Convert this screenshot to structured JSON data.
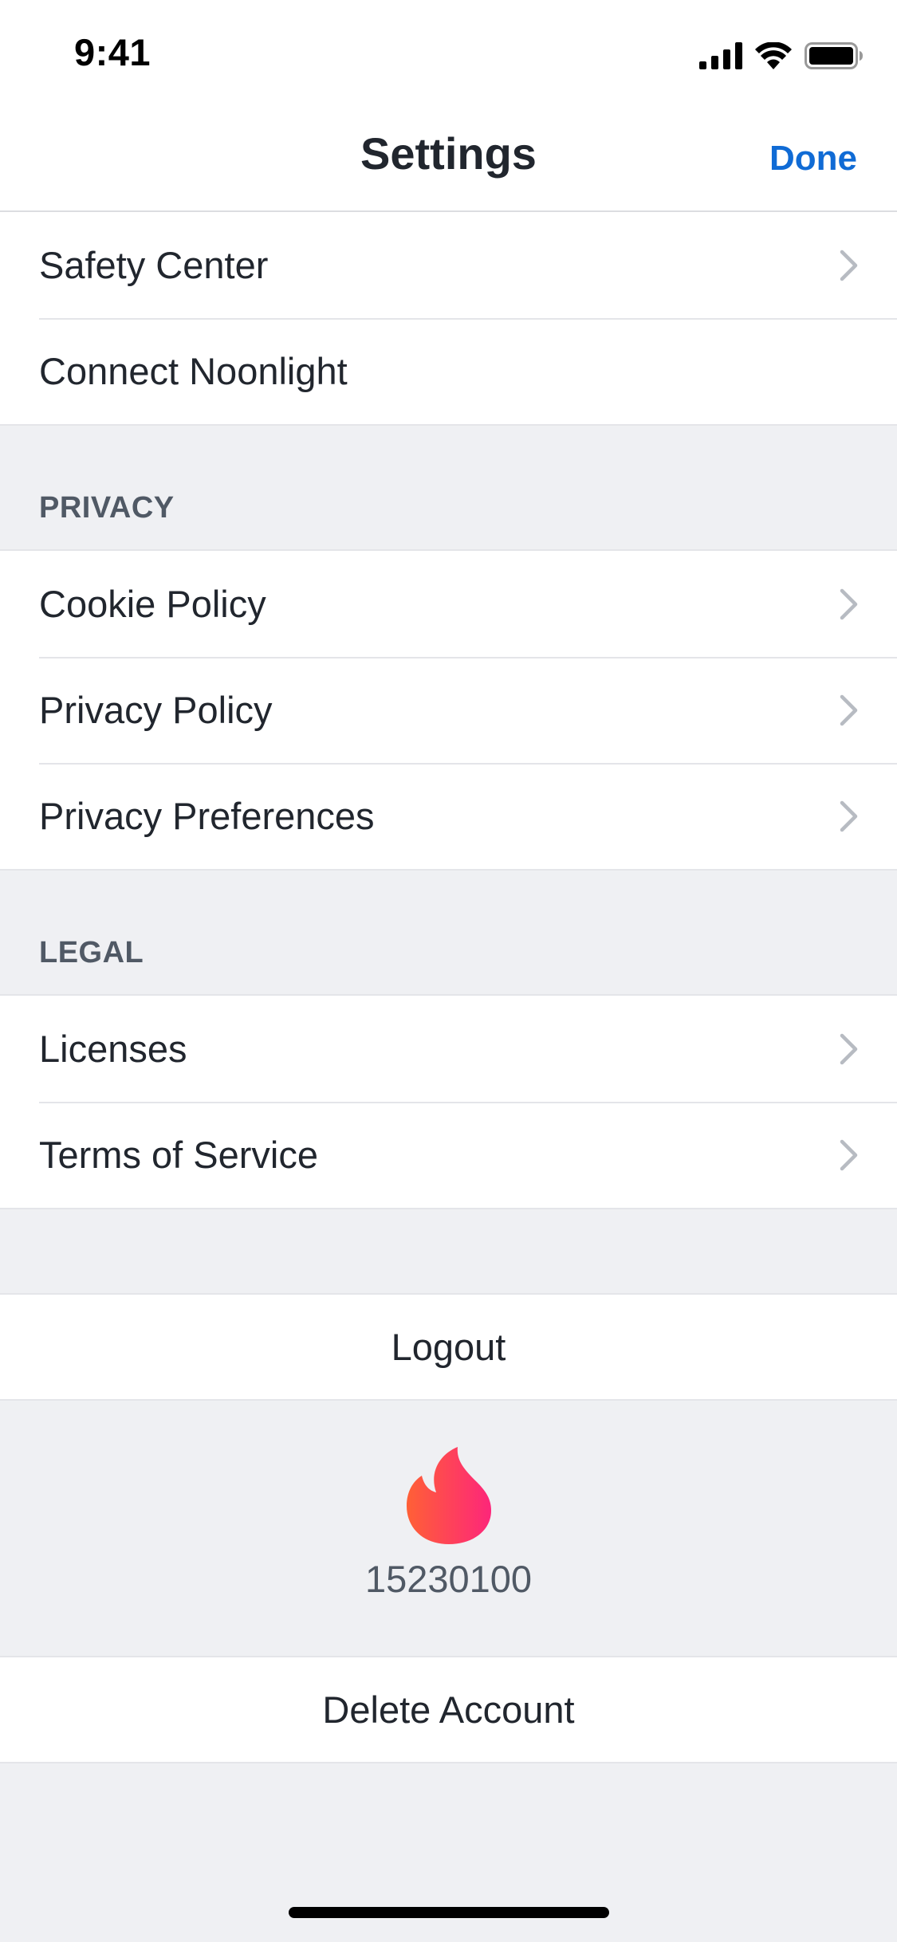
{
  "status_bar": {
    "time": "9:41",
    "icons": [
      "cellular-signal-icon",
      "wifi-icon",
      "battery-icon"
    ]
  },
  "nav": {
    "title": "Settings",
    "done_label": "Done"
  },
  "safety_group": {
    "items": [
      {
        "label": "Safety Center",
        "chevron": true
      },
      {
        "label": "Connect Noonlight",
        "chevron": false
      }
    ]
  },
  "privacy": {
    "header": "PRIVACY",
    "items": [
      {
        "label": "Cookie Policy",
        "chevron": true
      },
      {
        "label": "Privacy Policy",
        "chevron": true
      },
      {
        "label": "Privacy Preferences",
        "chevron": true
      }
    ]
  },
  "legal": {
    "header": "LEGAL",
    "items": [
      {
        "label": "Licenses",
        "chevron": true
      },
      {
        "label": "Terms of Service",
        "chevron": true
      }
    ]
  },
  "logout_label": "Logout",
  "app_info": {
    "logo_icon": "flame-icon",
    "version": "15230100"
  },
  "delete_account_label": "Delete Account",
  "colors": {
    "accent": "#106bd5",
    "background": "#eff0f3",
    "text": "#21262e",
    "section_header": "#505965",
    "flame_gradient_start": "#ff6036",
    "flame_gradient_end": "#fd267a"
  }
}
